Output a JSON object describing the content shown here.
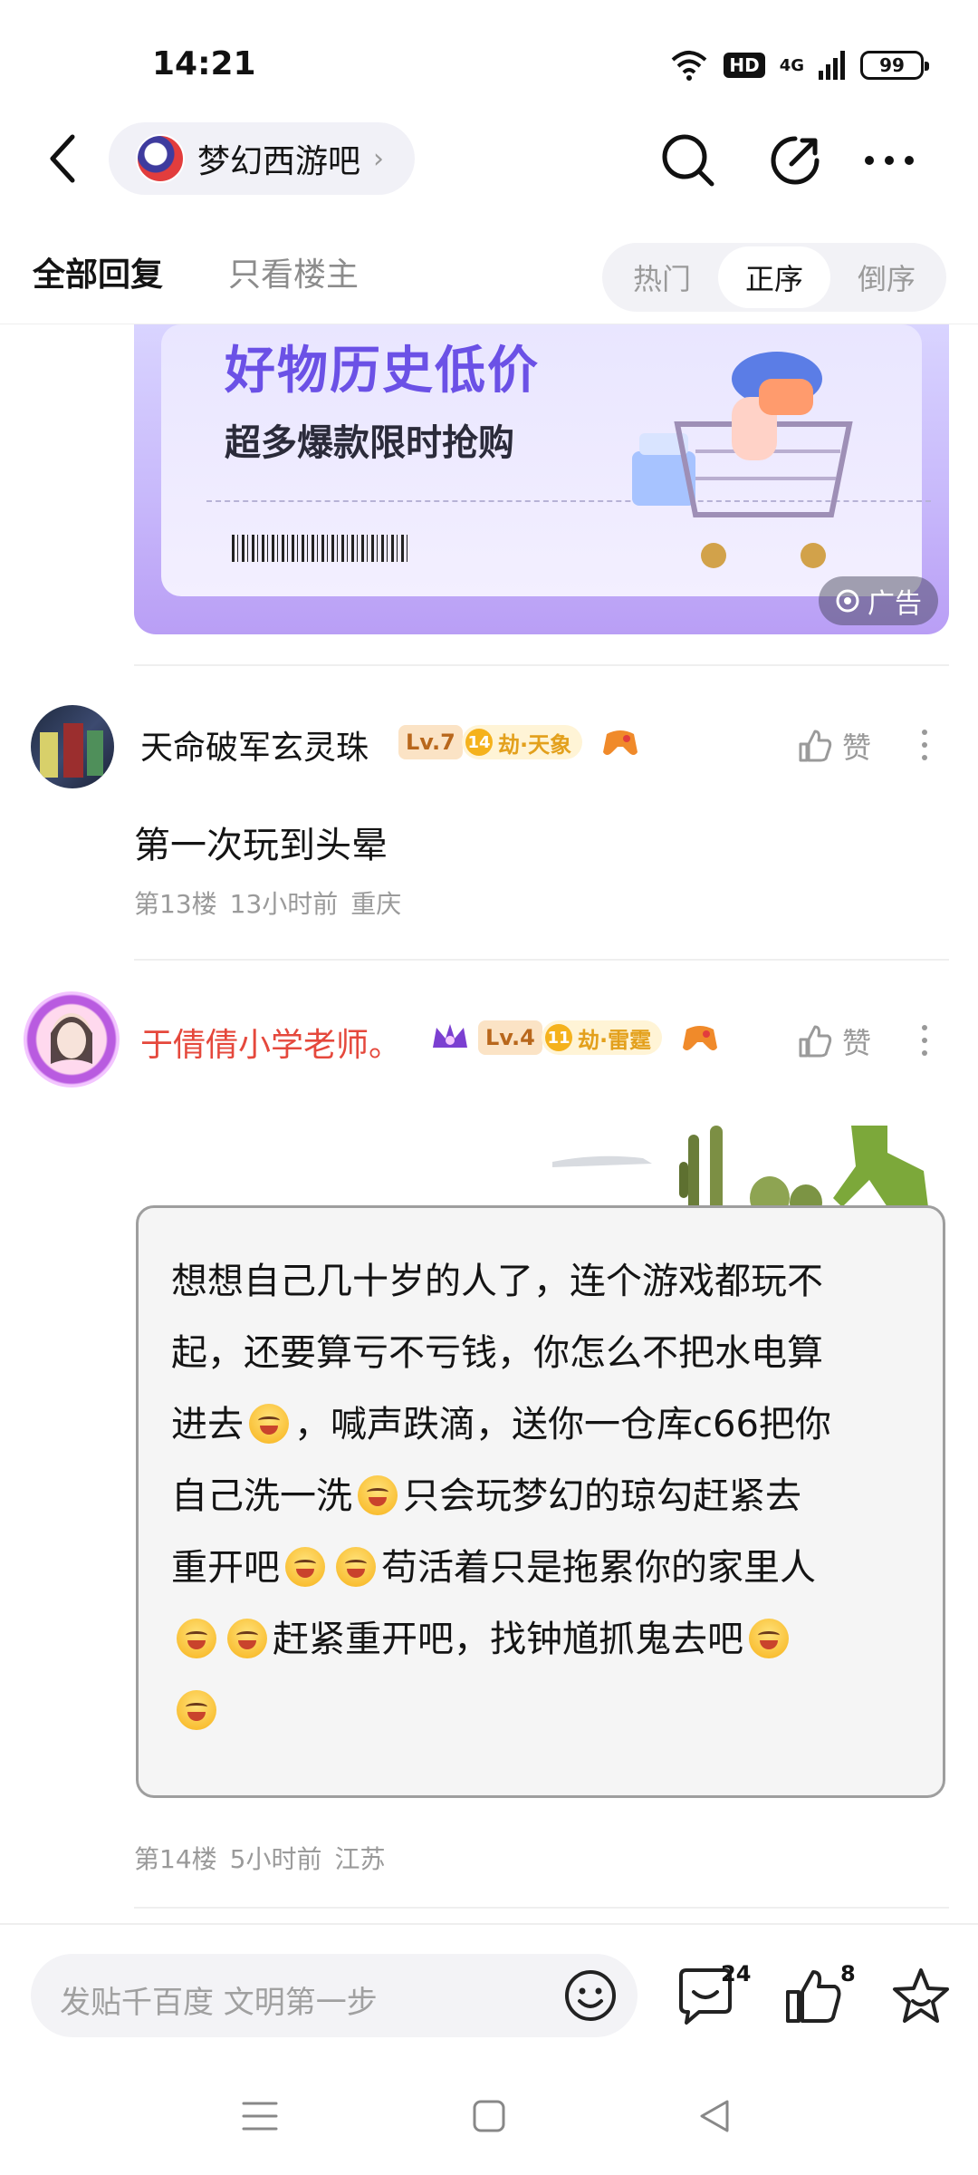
{
  "status_bar": {
    "time": "14:21",
    "hd_label": "HD",
    "network_label": "4G",
    "battery": "99"
  },
  "nav": {
    "forum_name": "梦幻西游吧",
    "chevron": "›"
  },
  "tabs": {
    "all_replies": "全部回复",
    "owner_only": "只看楼主",
    "sort_options": [
      "热门",
      "正序",
      "倒序"
    ],
    "active_sort": "正序"
  },
  "ad": {
    "title": "好物历史低价",
    "subtitle": "超多爆款限时抢购",
    "tag": "广告"
  },
  "posts": [
    {
      "username": "天命破军玄灵珠",
      "level": "Lv.7",
      "rank_num": "14",
      "rank_label": "劫·天象",
      "like_label": "赞",
      "content": "第一次玩到头晕",
      "floor": "第13楼",
      "time": "13小时前",
      "location": "重庆"
    },
    {
      "username": "于倩倩小学老师。",
      "username_color": "#e5483c",
      "level": "Lv.4",
      "rank_num": "11",
      "rank_label": "劫·雷霆",
      "like_label": "赞",
      "content_lines": [
        "想想自己几十岁的人了，连个游戏都玩不",
        "起，还要算亏不亏钱，你怎么不把水电算",
        "进去",
        "，喊声跌滴，送你一仓库c66把你",
        "自己洗一洗",
        "只会玩梦幻的琼勾赶紧去",
        "重开吧",
        "苟活着只是拖累你的家里人",
        "赶紧重开吧，找钟馗抓鬼去吧"
      ],
      "floor": "第14楼",
      "time": "5小时前",
      "location": "江苏"
    }
  ],
  "bottom_bar": {
    "input_placeholder": "发贴千百度 文明第一步",
    "comment_count": "24",
    "like_count": "8"
  },
  "colors": {
    "accent_purple": "#6b51e6",
    "red_username": "#e5483c",
    "muted": "#9a9a9a"
  }
}
